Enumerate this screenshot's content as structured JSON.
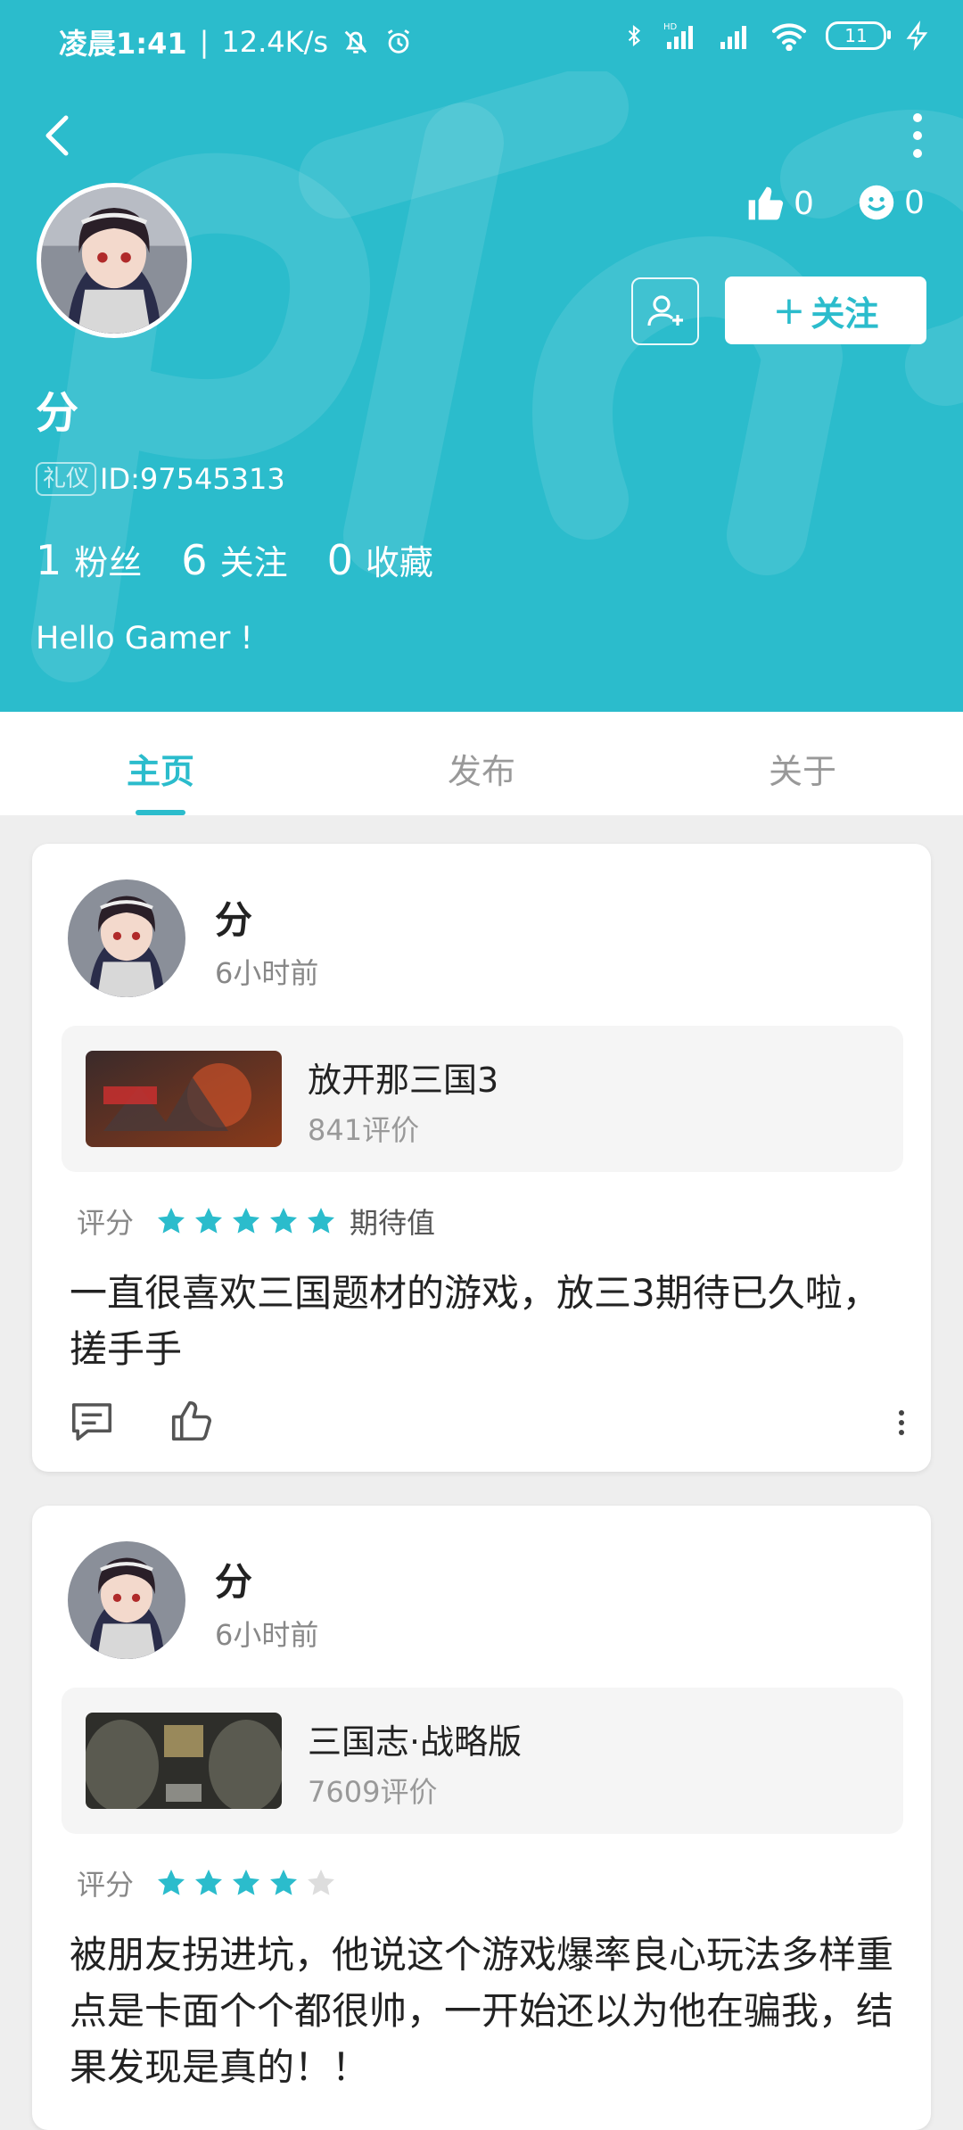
{
  "status_bar": {
    "time": "凌晨1:41",
    "speed": "12.4K/s",
    "battery": "11"
  },
  "profile": {
    "name": "分",
    "id_tag": "礼仪",
    "id_text": "ID:97545313",
    "likes": "0",
    "smiles": "0",
    "follow_label": "关注",
    "fans_count": "1",
    "fans_label": "粉丝",
    "following_count": "6",
    "following_label": "关注",
    "favorites_count": "0",
    "favorites_label": "收藏",
    "bio": "Hello Gamer !"
  },
  "tabs": [
    {
      "label": "主页"
    },
    {
      "label": "发布"
    },
    {
      "label": "关于"
    }
  ],
  "posts": [
    {
      "author": "分",
      "time": "6小时前",
      "game_name": "放开那三国3",
      "game_reviews": "841评价",
      "rating_label": "评分",
      "rating": 5,
      "rating_extra": "期待值",
      "text": "一直很喜欢三国题材的游戏，放三3期待已久啦，搓手手"
    },
    {
      "author": "分",
      "time": "6小时前",
      "game_name": "三国志·战略版",
      "game_reviews": "7609评价",
      "rating_label": "评分",
      "rating": 4,
      "text": "被朋友拐进坑，他说这个游戏爆率良心玩法多样重点是卡面个个都很帅，一开始还以为他在骗我，结果发现是真的！！"
    }
  ],
  "colors": {
    "accent": "#2bbccc",
    "star_on": "#2bbccc",
    "star_off": "#dddddd"
  }
}
